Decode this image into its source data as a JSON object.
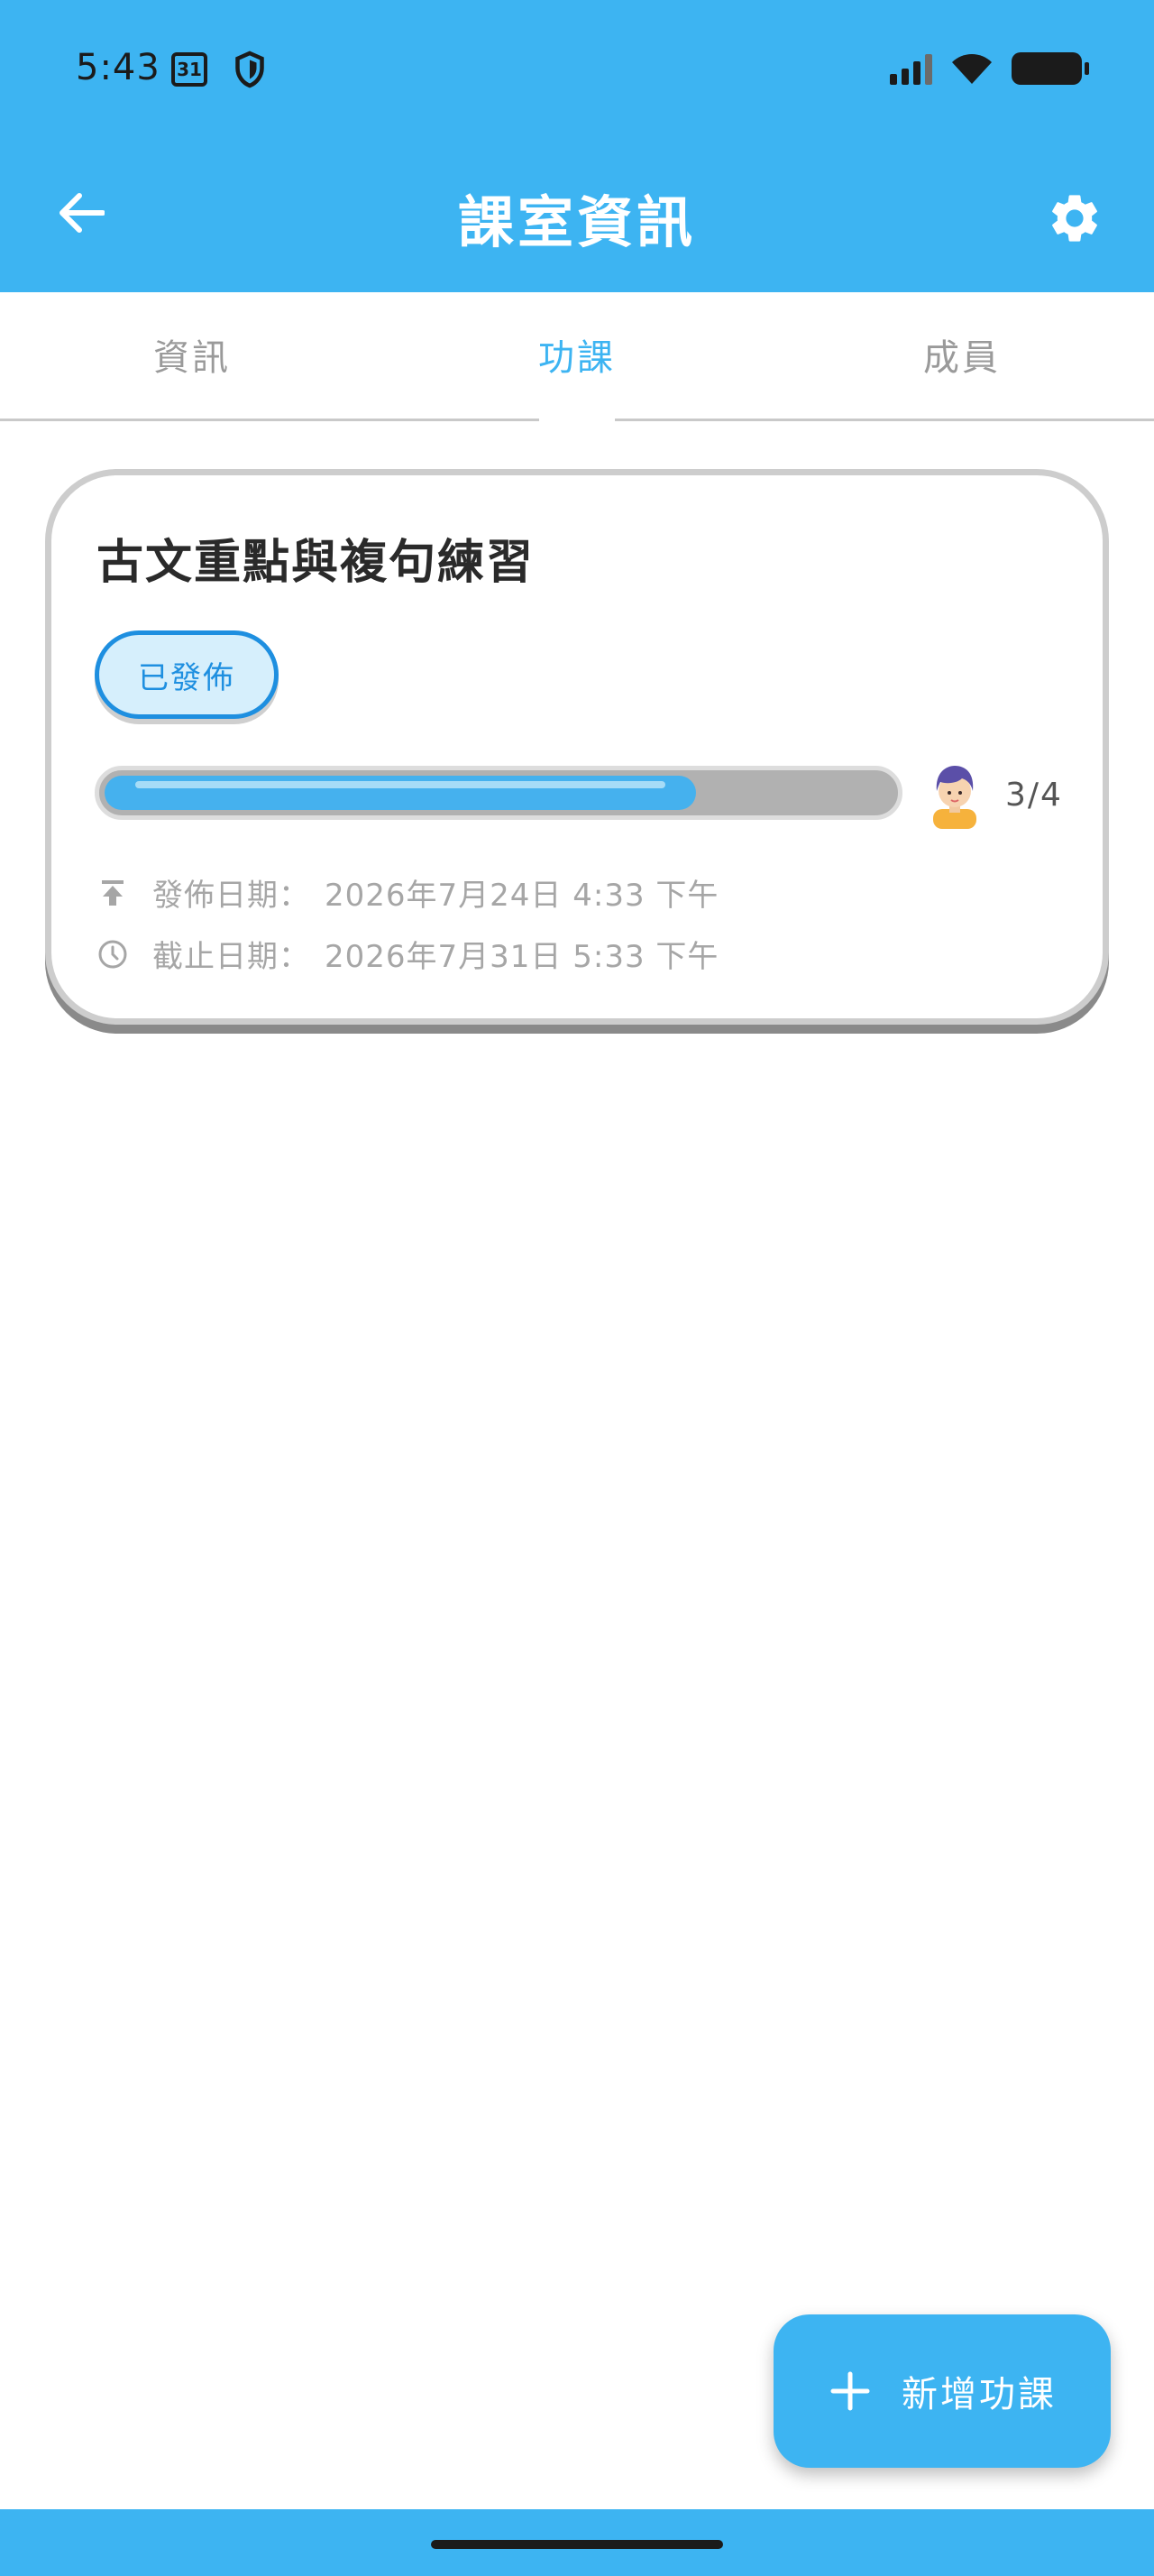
{
  "status_bar": {
    "time": "5:43",
    "calendar_day": "31"
  },
  "app_bar": {
    "title": "課室資訊",
    "back_icon": "arrow-left-icon",
    "settings_icon": "gear-icon"
  },
  "tabs": [
    {
      "label": "資訊",
      "active": false
    },
    {
      "label": "功課",
      "active": true
    },
    {
      "label": "成員",
      "active": false
    }
  ],
  "assignment": {
    "title": "古文重點與複句練習",
    "status": "已發佈",
    "progress": 0.75,
    "submitted": "3/4",
    "publish_label": "發佈日期：",
    "publish_date": "2026年7月24日 4:33 下午",
    "due_label": "截止日期：",
    "due_date": "2026年7月31日 5:33 下午"
  },
  "fab": {
    "label": "新增功課",
    "icon": "plus-icon"
  },
  "colors": {
    "primary": "#3DB4F2",
    "badge_border": "#1E8FE0",
    "badge_bg": "#D6EFFC",
    "muted_text": "#A6A6A6"
  }
}
